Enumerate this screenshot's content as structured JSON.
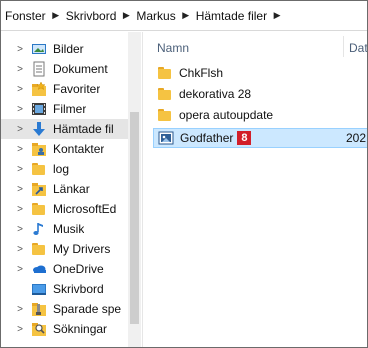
{
  "breadcrumb": [
    "Fonster",
    "Skrivbord",
    "Markus",
    "Hämtade filer"
  ],
  "nav": [
    {
      "label": "Bilder",
      "icon": "pictures-icon",
      "chev": ">"
    },
    {
      "label": "Dokument",
      "icon": "documents-icon",
      "chev": ">"
    },
    {
      "label": "Favoriter",
      "icon": "favorites-icon",
      "chev": ">"
    },
    {
      "label": "Filmer",
      "icon": "videos-icon",
      "chev": ">"
    },
    {
      "label": "Hämtade fil",
      "icon": "downloads-icon",
      "chev": ">",
      "selected": true
    },
    {
      "label": "Kontakter",
      "icon": "contacts-icon",
      "chev": ">"
    },
    {
      "label": "log",
      "icon": "folder-icon",
      "chev": ">"
    },
    {
      "label": "Länkar",
      "icon": "links-icon",
      "chev": ">"
    },
    {
      "label": "MicrosoftEd",
      "icon": "folder-icon",
      "chev": ">"
    },
    {
      "label": "Musik",
      "icon": "music-icon",
      "chev": ">"
    },
    {
      "label": "My Drivers",
      "icon": "folder-icon",
      "chev": ">"
    },
    {
      "label": "OneDrive",
      "icon": "onedrive-icon",
      "chev": ">"
    },
    {
      "label": "Skrivbord",
      "icon": "desktop-icon",
      "chev": ""
    },
    {
      "label": "Sparade spe",
      "icon": "saved-games-icon",
      "chev": ">"
    },
    {
      "label": "Sökningar",
      "icon": "searches-icon",
      "chev": ">"
    }
  ],
  "columns": {
    "name": "Namn",
    "date": "Dat"
  },
  "files": [
    {
      "name": "ChkFlsh",
      "icon": "folder-icon",
      "date": ""
    },
    {
      "name": "dekorativa 28",
      "icon": "folder-icon",
      "date": ""
    },
    {
      "name": "opera autoupdate",
      "icon": "folder-icon",
      "date": ""
    },
    {
      "name": "Godfather",
      "icon": "image-file-icon",
      "date": "202",
      "badge": "8",
      "selected": true
    }
  ],
  "colors": {
    "folder": "#f5c342",
    "selection": "#cce8ff",
    "badge": "#d21f2a",
    "navSelected": "#e5e5e5"
  }
}
